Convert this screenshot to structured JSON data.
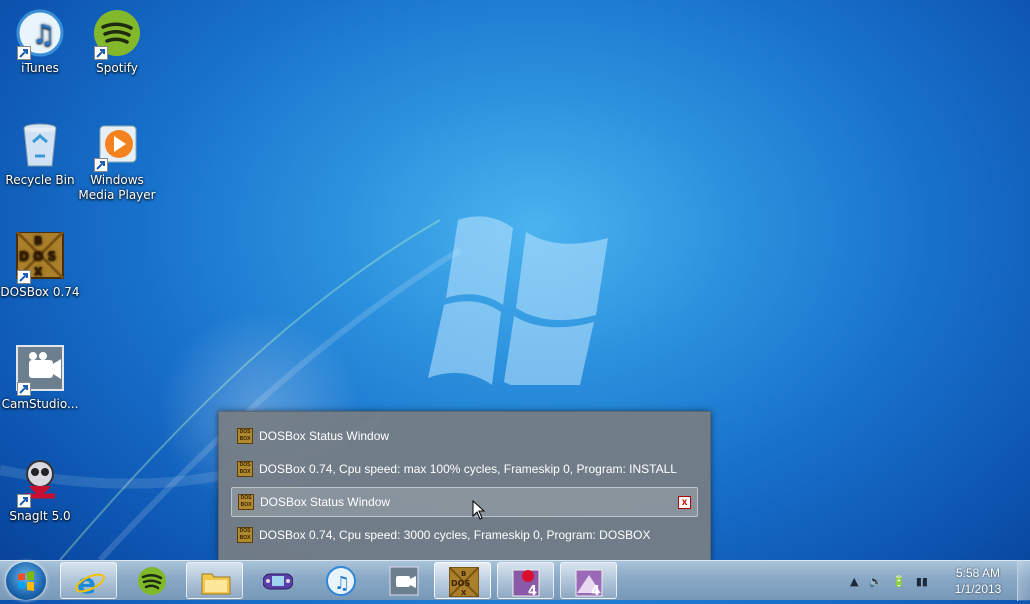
{
  "desktop": {
    "icons": [
      {
        "label": "iTunes",
        "icon": "itunes-icon"
      },
      {
        "label": "Spotify",
        "icon": "spotify-icon"
      },
      {
        "label": "Recycle Bin",
        "icon": "recycle-bin-icon"
      },
      {
        "label": "Windows Media Player",
        "icon": "media-player-icon"
      },
      {
        "label": "DOSBox 0.74",
        "icon": "dosbox-icon"
      },
      {
        "label": "CamStudio...",
        "icon": "camstudio-icon"
      },
      {
        "label": "SnagIt 5.0",
        "icon": "snagit-icon"
      }
    ]
  },
  "popup": {
    "items": [
      {
        "label": "DOSBox Status Window"
      },
      {
        "label": "DOSBox 0.74, Cpu speed: max 100% cycles, Frameskip  0, Program:  INSTALL"
      },
      {
        "label": "DOSBox Status Window",
        "selected": true,
        "close_label": "x"
      },
      {
        "label": "DOSBox 0.74, Cpu speed:     3000 cycles, Frameskip  0, Program:   DOSBOX"
      }
    ]
  },
  "taskbar": {
    "buttons": [
      {
        "icon": "internet-explorer-icon"
      },
      {
        "icon": "spotify-icon"
      },
      {
        "icon": "file-explorer-icon"
      },
      {
        "icon": "visual-boy-advance-icon"
      },
      {
        "icon": "itunes-icon"
      },
      {
        "icon": "camstudio-icon"
      },
      {
        "icon": "dosbox-icon"
      },
      {
        "icon": "snagit-editor-icon",
        "badge": "4"
      },
      {
        "icon": "picture-viewer-icon",
        "badge": "4"
      }
    ],
    "tray": {
      "clock_time": "5:58 AM",
      "clock_date": "1/1/2013"
    }
  },
  "colors": {
    "wallpaper": "#1a6fc9",
    "taskbar": "#88a8c6",
    "popup": "#767d84"
  }
}
